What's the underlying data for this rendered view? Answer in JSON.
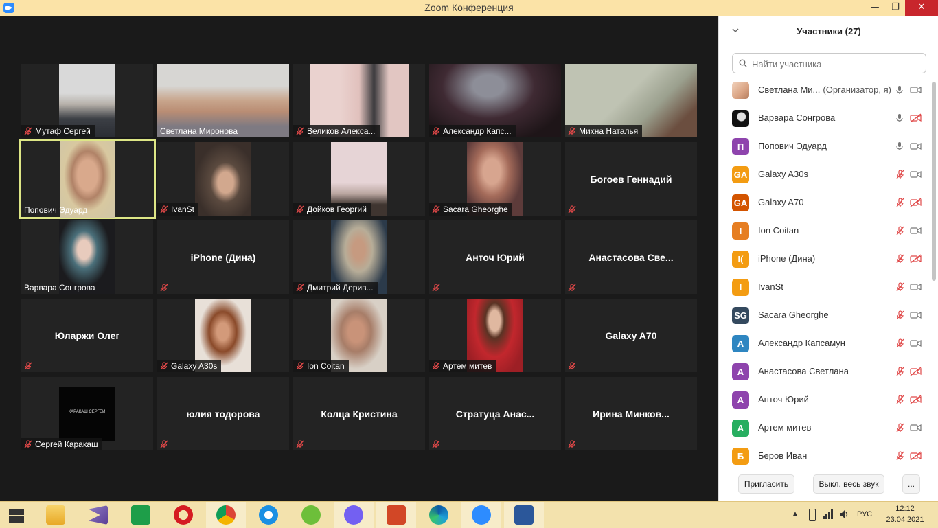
{
  "window": {
    "title": "Zoom Конференция",
    "minimize": "—",
    "restore": "❐",
    "close": "✕"
  },
  "tiles": [
    {
      "label": "Мутаф Сергей",
      "muted": true
    },
    {
      "label": "Светлана Миронова",
      "muted": false
    },
    {
      "label": "Великов Алекса...",
      "muted": true
    },
    {
      "label": "Александр Капс...",
      "muted": true
    },
    {
      "label": "Михна Наталья",
      "muted": true
    },
    {
      "label": "Попович Эдуард",
      "muted": false,
      "speaking": true
    },
    {
      "label": "IvanSt",
      "muted": true
    },
    {
      "label": "Дойков Георгий",
      "muted": true
    },
    {
      "label": "Sacara Gheorghe",
      "muted": true
    },
    {
      "name": "Богоев Геннадий",
      "muted": true
    },
    {
      "label": "Варвара Сонгрова",
      "muted": false
    },
    {
      "name": "iPhone (Дина)",
      "muted": true
    },
    {
      "label": "Дмитрий Дерив...",
      "muted": true
    },
    {
      "name": "Анточ Юрий",
      "muted": true
    },
    {
      "name": "Анастасова  Све...",
      "muted": true
    },
    {
      "name": "Юларжи Олег",
      "muted": true
    },
    {
      "label": "Galaxy A30s",
      "muted": true
    },
    {
      "label": "Ion Coitan",
      "muted": true
    },
    {
      "label": "Артем митев",
      "muted": true
    },
    {
      "name": "Galaxy A70",
      "muted": true
    },
    {
      "label": "Сергей Каракаш",
      "muted": true,
      "screen_text": "КАРАКАШ СЕРГЕЙ"
    },
    {
      "name": "юлия тодорова",
      "muted": true
    },
    {
      "name": "Колца Кристина",
      "muted": true
    },
    {
      "name": "Стратуца   Анас...",
      "muted": true
    },
    {
      "name": "Ирина  Минков...",
      "muted": true
    }
  ],
  "panel": {
    "title": "Участники (27)",
    "search_placeholder": "Найти участника",
    "participants": [
      {
        "name": "Светлана Ми...",
        "role": "(Организатор, я)",
        "avatar": "",
        "avatar_color": "photo1",
        "mic": "on",
        "cam": "on"
      },
      {
        "name": "Варвара Сонгрова",
        "avatar": "",
        "avatar_color": "photo2",
        "mic": "on",
        "cam": "off"
      },
      {
        "name": "Попович Эдуард",
        "avatar": "П",
        "avatar_color": "#8e44ad",
        "mic": "on",
        "cam": "on"
      },
      {
        "name": "Galaxy A30s",
        "avatar": "GA",
        "avatar_color": "#f39c12",
        "mic": "off",
        "cam": "on"
      },
      {
        "name": "Galaxy A70",
        "avatar": "GA",
        "avatar_color": "#d35400",
        "mic": "off",
        "cam": "off"
      },
      {
        "name": "Ion Coitan",
        "avatar": "I",
        "avatar_color": "#e67e22",
        "mic": "off",
        "cam": "on"
      },
      {
        "name": "iPhone (Дина)",
        "avatar": "I(",
        "avatar_color": "#f39c12",
        "mic": "off",
        "cam": "off"
      },
      {
        "name": "IvanSt",
        "avatar": "I",
        "avatar_color": "#f39c12",
        "mic": "off",
        "cam": "on"
      },
      {
        "name": "Sacara Gheorghe",
        "avatar": "SG",
        "avatar_color": "#34495e",
        "mic": "off",
        "cam": "on"
      },
      {
        "name": "Александр Капсамун",
        "avatar": "А",
        "avatar_color": "#2e86c1",
        "mic": "off",
        "cam": "on"
      },
      {
        "name": "Анастасова Светлана",
        "avatar": "А",
        "avatar_color": "#8e44ad",
        "mic": "off",
        "cam": "off"
      },
      {
        "name": "Анточ Юрий",
        "avatar": "А",
        "avatar_color": "#8e44ad",
        "mic": "off",
        "cam": "off"
      },
      {
        "name": "Артем митев",
        "avatar": "А",
        "avatar_color": "#27ae60",
        "mic": "off",
        "cam": "on"
      },
      {
        "name": "Беров Иван",
        "avatar": "Б",
        "avatar_color": "#f39c12",
        "mic": "off",
        "cam": "off"
      }
    ],
    "invite_label": "Пригласить",
    "mute_all_label": "Выкл. весь звук",
    "more_label": "..."
  },
  "taskbar": {
    "apps": [
      "windows-start",
      "file-explorer",
      "visual-studio",
      "microsoft-store",
      "opera",
      "chrome",
      "internet-explorer",
      "utorrent",
      "viber",
      "powerpoint",
      "edge",
      "zoom",
      "word"
    ],
    "lang": "РУС",
    "time": "12:12",
    "date": "23.04.2021"
  }
}
